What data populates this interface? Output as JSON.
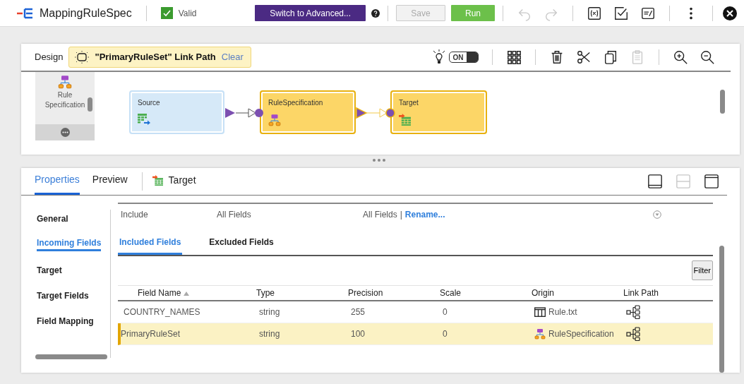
{
  "app": {
    "title": "MappingRuleSpec",
    "valid": {
      "label": "Valid",
      "checked": true
    }
  },
  "toolbar": {
    "switch_button": "Switch to Advanced...",
    "buttons": [
      {
        "label": "Save",
        "kind": "save",
        "disabled": true
      },
      {
        "label": "Run",
        "kind": "run",
        "disabled": false
      }
    ],
    "icons": [
      {
        "kind": "undo",
        "disabled": true
      },
      {
        "kind": "redo",
        "disabled": true
      },
      {
        "kind": "sep"
      },
      {
        "kind": "formula",
        "disabled": false
      },
      {
        "kind": "validate",
        "disabled": false
      },
      {
        "kind": "params",
        "disabled": false
      },
      {
        "kind": "sep"
      },
      {
        "kind": "more",
        "disabled": false
      }
    ]
  },
  "design": {
    "title": "Design",
    "highlight": {
      "label": "\"PrimaryRuleSet\" Link Path",
      "clear": "Clear"
    },
    "toggle": {
      "label": "ON",
      "on": true
    },
    "tools": [
      {
        "kind": "arrange",
        "disabled": false
      },
      {
        "kind": "sep"
      },
      {
        "kind": "delete",
        "disabled": false
      },
      {
        "kind": "cut",
        "disabled": false
      },
      {
        "kind": "copy",
        "disabled": false
      },
      {
        "kind": "paste",
        "disabled": true
      },
      {
        "kind": "sep"
      },
      {
        "kind": "zoom_in",
        "disabled": false
      },
      {
        "kind": "zoom_out",
        "disabled": false
      }
    ],
    "palette": [
      {
        "label": "Rule Specification"
      }
    ],
    "nodes": [
      {
        "label": "Source",
        "kind": "source",
        "highlighted": false
      },
      {
        "label": "RuleSpecification",
        "kind": "rule",
        "highlighted": true
      },
      {
        "label": "Target",
        "kind": "target",
        "highlighted": true
      }
    ]
  },
  "properties": {
    "tabs": [
      {
        "label": "Properties",
        "selected": true
      },
      {
        "label": "Preview",
        "selected": false
      }
    ],
    "object": "Target",
    "layout_buttons": [
      {
        "kind": "bottom",
        "disabled": false
      },
      {
        "kind": "split",
        "disabled": true
      },
      {
        "kind": "top",
        "disabled": false
      }
    ],
    "nav": [
      {
        "label": "General",
        "selected": false
      },
      {
        "label": "Incoming Fields",
        "selected": true
      },
      {
        "label": "Target",
        "selected": false
      },
      {
        "label": "Target Fields",
        "selected": false
      },
      {
        "label": "Field Mapping",
        "selected": false
      }
    ],
    "rule": {
      "operator": "Include",
      "criteria": "All Fields",
      "detail": "All Fields",
      "separator": "|",
      "link": "Rename..."
    },
    "field_tabs": [
      {
        "label": "Included Fields",
        "selected": true
      },
      {
        "label": "Excluded Fields",
        "selected": false
      }
    ],
    "filter": "Filter",
    "columns": [
      {
        "label": "Field Name",
        "sorted": true
      },
      {
        "label": "Type",
        "sorted": false
      },
      {
        "label": "Precision",
        "sorted": false
      },
      {
        "label": "Scale",
        "sorted": false
      },
      {
        "label": "Origin",
        "sorted": false
      },
      {
        "label": "Link Path",
        "sorted": false
      }
    ],
    "rows": [
      {
        "name": "COUNTRY_NAMES",
        "type": "string",
        "precision": "255",
        "scale": "0",
        "origin": "Rule.txt",
        "kind": "file",
        "selected": false
      },
      {
        "name": "PrimaryRuleSet",
        "type": "string",
        "precision": "100",
        "scale": "0",
        "origin": "RuleSpecification",
        "kind": "rule",
        "selected": true
      }
    ]
  }
}
